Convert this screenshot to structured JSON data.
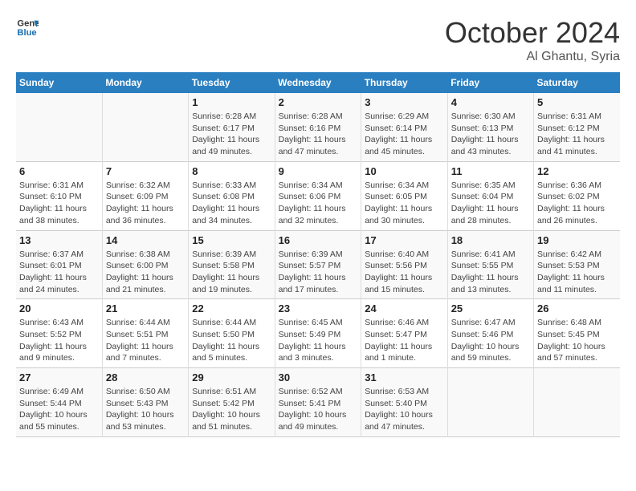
{
  "header": {
    "logo_line1": "General",
    "logo_line2": "Blue",
    "month": "October 2024",
    "location": "Al Ghantu, Syria"
  },
  "weekdays": [
    "Sunday",
    "Monday",
    "Tuesday",
    "Wednesday",
    "Thursday",
    "Friday",
    "Saturday"
  ],
  "weeks": [
    [
      {
        "day": "",
        "detail": ""
      },
      {
        "day": "",
        "detail": ""
      },
      {
        "day": "1",
        "detail": "Sunrise: 6:28 AM\nSunset: 6:17 PM\nDaylight: 11 hours and 49 minutes."
      },
      {
        "day": "2",
        "detail": "Sunrise: 6:28 AM\nSunset: 6:16 PM\nDaylight: 11 hours and 47 minutes."
      },
      {
        "day": "3",
        "detail": "Sunrise: 6:29 AM\nSunset: 6:14 PM\nDaylight: 11 hours and 45 minutes."
      },
      {
        "day": "4",
        "detail": "Sunrise: 6:30 AM\nSunset: 6:13 PM\nDaylight: 11 hours and 43 minutes."
      },
      {
        "day": "5",
        "detail": "Sunrise: 6:31 AM\nSunset: 6:12 PM\nDaylight: 11 hours and 41 minutes."
      }
    ],
    [
      {
        "day": "6",
        "detail": "Sunrise: 6:31 AM\nSunset: 6:10 PM\nDaylight: 11 hours and 38 minutes."
      },
      {
        "day": "7",
        "detail": "Sunrise: 6:32 AM\nSunset: 6:09 PM\nDaylight: 11 hours and 36 minutes."
      },
      {
        "day": "8",
        "detail": "Sunrise: 6:33 AM\nSunset: 6:08 PM\nDaylight: 11 hours and 34 minutes."
      },
      {
        "day": "9",
        "detail": "Sunrise: 6:34 AM\nSunset: 6:06 PM\nDaylight: 11 hours and 32 minutes."
      },
      {
        "day": "10",
        "detail": "Sunrise: 6:34 AM\nSunset: 6:05 PM\nDaylight: 11 hours and 30 minutes."
      },
      {
        "day": "11",
        "detail": "Sunrise: 6:35 AM\nSunset: 6:04 PM\nDaylight: 11 hours and 28 minutes."
      },
      {
        "day": "12",
        "detail": "Sunrise: 6:36 AM\nSunset: 6:02 PM\nDaylight: 11 hours and 26 minutes."
      }
    ],
    [
      {
        "day": "13",
        "detail": "Sunrise: 6:37 AM\nSunset: 6:01 PM\nDaylight: 11 hours and 24 minutes."
      },
      {
        "day": "14",
        "detail": "Sunrise: 6:38 AM\nSunset: 6:00 PM\nDaylight: 11 hours and 21 minutes."
      },
      {
        "day": "15",
        "detail": "Sunrise: 6:39 AM\nSunset: 5:58 PM\nDaylight: 11 hours and 19 minutes."
      },
      {
        "day": "16",
        "detail": "Sunrise: 6:39 AM\nSunset: 5:57 PM\nDaylight: 11 hours and 17 minutes."
      },
      {
        "day": "17",
        "detail": "Sunrise: 6:40 AM\nSunset: 5:56 PM\nDaylight: 11 hours and 15 minutes."
      },
      {
        "day": "18",
        "detail": "Sunrise: 6:41 AM\nSunset: 5:55 PM\nDaylight: 11 hours and 13 minutes."
      },
      {
        "day": "19",
        "detail": "Sunrise: 6:42 AM\nSunset: 5:53 PM\nDaylight: 11 hours and 11 minutes."
      }
    ],
    [
      {
        "day": "20",
        "detail": "Sunrise: 6:43 AM\nSunset: 5:52 PM\nDaylight: 11 hours and 9 minutes."
      },
      {
        "day": "21",
        "detail": "Sunrise: 6:44 AM\nSunset: 5:51 PM\nDaylight: 11 hours and 7 minutes."
      },
      {
        "day": "22",
        "detail": "Sunrise: 6:44 AM\nSunset: 5:50 PM\nDaylight: 11 hours and 5 minutes."
      },
      {
        "day": "23",
        "detail": "Sunrise: 6:45 AM\nSunset: 5:49 PM\nDaylight: 11 hours and 3 minutes."
      },
      {
        "day": "24",
        "detail": "Sunrise: 6:46 AM\nSunset: 5:47 PM\nDaylight: 11 hours and 1 minute."
      },
      {
        "day": "25",
        "detail": "Sunrise: 6:47 AM\nSunset: 5:46 PM\nDaylight: 10 hours and 59 minutes."
      },
      {
        "day": "26",
        "detail": "Sunrise: 6:48 AM\nSunset: 5:45 PM\nDaylight: 10 hours and 57 minutes."
      }
    ],
    [
      {
        "day": "27",
        "detail": "Sunrise: 6:49 AM\nSunset: 5:44 PM\nDaylight: 10 hours and 55 minutes."
      },
      {
        "day": "28",
        "detail": "Sunrise: 6:50 AM\nSunset: 5:43 PM\nDaylight: 10 hours and 53 minutes."
      },
      {
        "day": "29",
        "detail": "Sunrise: 6:51 AM\nSunset: 5:42 PM\nDaylight: 10 hours and 51 minutes."
      },
      {
        "day": "30",
        "detail": "Sunrise: 6:52 AM\nSunset: 5:41 PM\nDaylight: 10 hours and 49 minutes."
      },
      {
        "day": "31",
        "detail": "Sunrise: 6:53 AM\nSunset: 5:40 PM\nDaylight: 10 hours and 47 minutes."
      },
      {
        "day": "",
        "detail": ""
      },
      {
        "day": "",
        "detail": ""
      }
    ]
  ]
}
